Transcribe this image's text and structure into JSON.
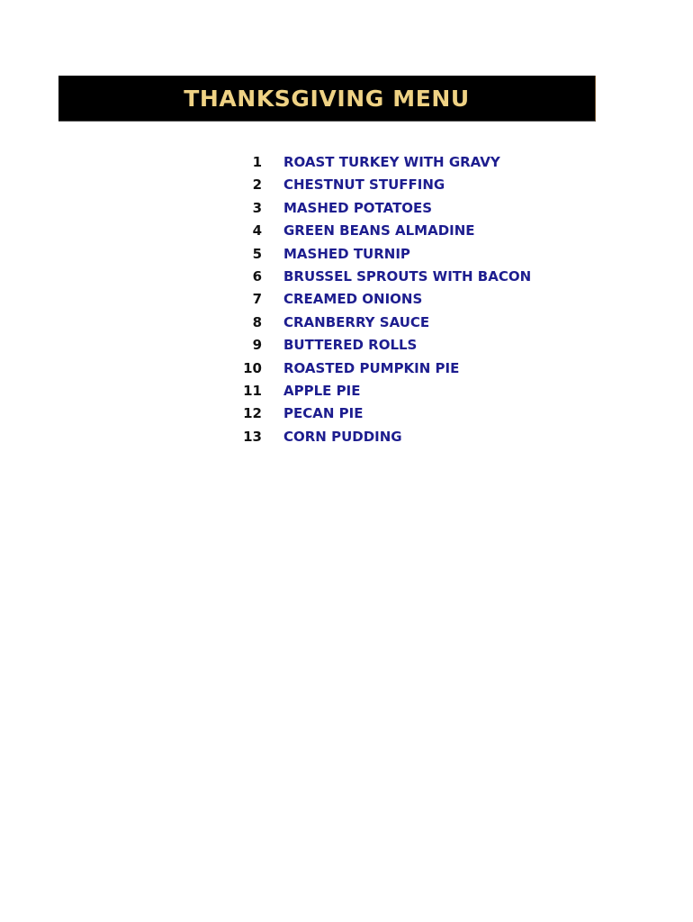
{
  "document": {
    "title": "THANKSGIVING MENU",
    "banner_background_color": "#000000",
    "title_text_color": "#EFD284",
    "item_text_color": "#1D1D8F",
    "item_number_color": "#121212",
    "page_background_color": "#FFFFFF"
  },
  "menu": {
    "items": [
      {
        "number": "1",
        "label": "ROAST TURKEY WITH GRAVY"
      },
      {
        "number": "2",
        "label": "CHESTNUT STUFFING"
      },
      {
        "number": "3",
        "label": "MASHED POTATOES"
      },
      {
        "number": "4",
        "label": "GREEN BEANS ALMADINE"
      },
      {
        "number": "5",
        "label": "MASHED TURNIP"
      },
      {
        "number": "6",
        "label": "BRUSSEL SPROUTS WITH BACON"
      },
      {
        "number": "7",
        "label": "CREAMED ONIONS"
      },
      {
        "number": "8",
        "label": "CRANBERRY SAUCE"
      },
      {
        "number": "9",
        "label": "BUTTERED ROLLS"
      },
      {
        "number": "10",
        "label": "ROASTED PUMPKIN PIE"
      },
      {
        "number": "11",
        "label": "APPLE PIE"
      },
      {
        "number": "12",
        "label": "PECAN PIE"
      },
      {
        "number": "13",
        "label": "CORN PUDDING"
      }
    ]
  }
}
